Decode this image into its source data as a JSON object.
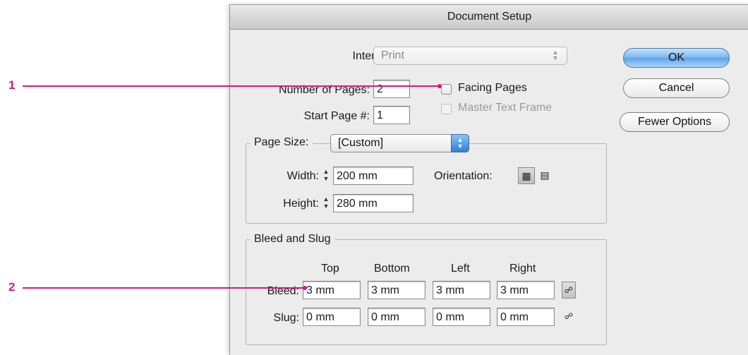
{
  "dialog": {
    "title": "Document Setup",
    "intent": {
      "label": "Intent:",
      "value": "Print"
    },
    "number_of_pages": {
      "label": "Number of Pages:",
      "value": "2"
    },
    "start_page": {
      "label": "Start Page #:",
      "value": "1"
    },
    "facing_pages": {
      "label": "Facing Pages",
      "checked": false
    },
    "master_text_frame": {
      "label": "Master Text Frame",
      "checked": false,
      "enabled": false
    },
    "page_size": {
      "group_label": "Page Size:",
      "value": "[Custom]",
      "width_label": "Width:",
      "width_value": "200 mm",
      "height_label": "Height:",
      "height_value": "280 mm",
      "orientation_label": "Orientation:",
      "orientation_selected": "portrait"
    },
    "bleed_slug": {
      "group_label": "Bleed and Slug",
      "columns": [
        "Top",
        "Bottom",
        "Left",
        "Right"
      ],
      "bleed_label": "Bleed:",
      "bleed_values": [
        "3 mm",
        "3 mm",
        "3 mm",
        "3 mm"
      ],
      "slug_label": "Slug:",
      "slug_values": [
        "0 mm",
        "0 mm",
        "0 mm",
        "0 mm"
      ]
    },
    "buttons": {
      "ok": "OK",
      "cancel": "Cancel",
      "fewer_options": "Fewer Options"
    }
  },
  "callouts": [
    "1",
    "2"
  ],
  "colors": {
    "callout": "#d4197f",
    "default_button": "#5da4ea"
  },
  "icons": {
    "stepper": "stepper-arrows-icon",
    "portrait": "portrait-orientation-icon",
    "landscape": "landscape-orientation-icon",
    "link": "chain-link-icon"
  }
}
